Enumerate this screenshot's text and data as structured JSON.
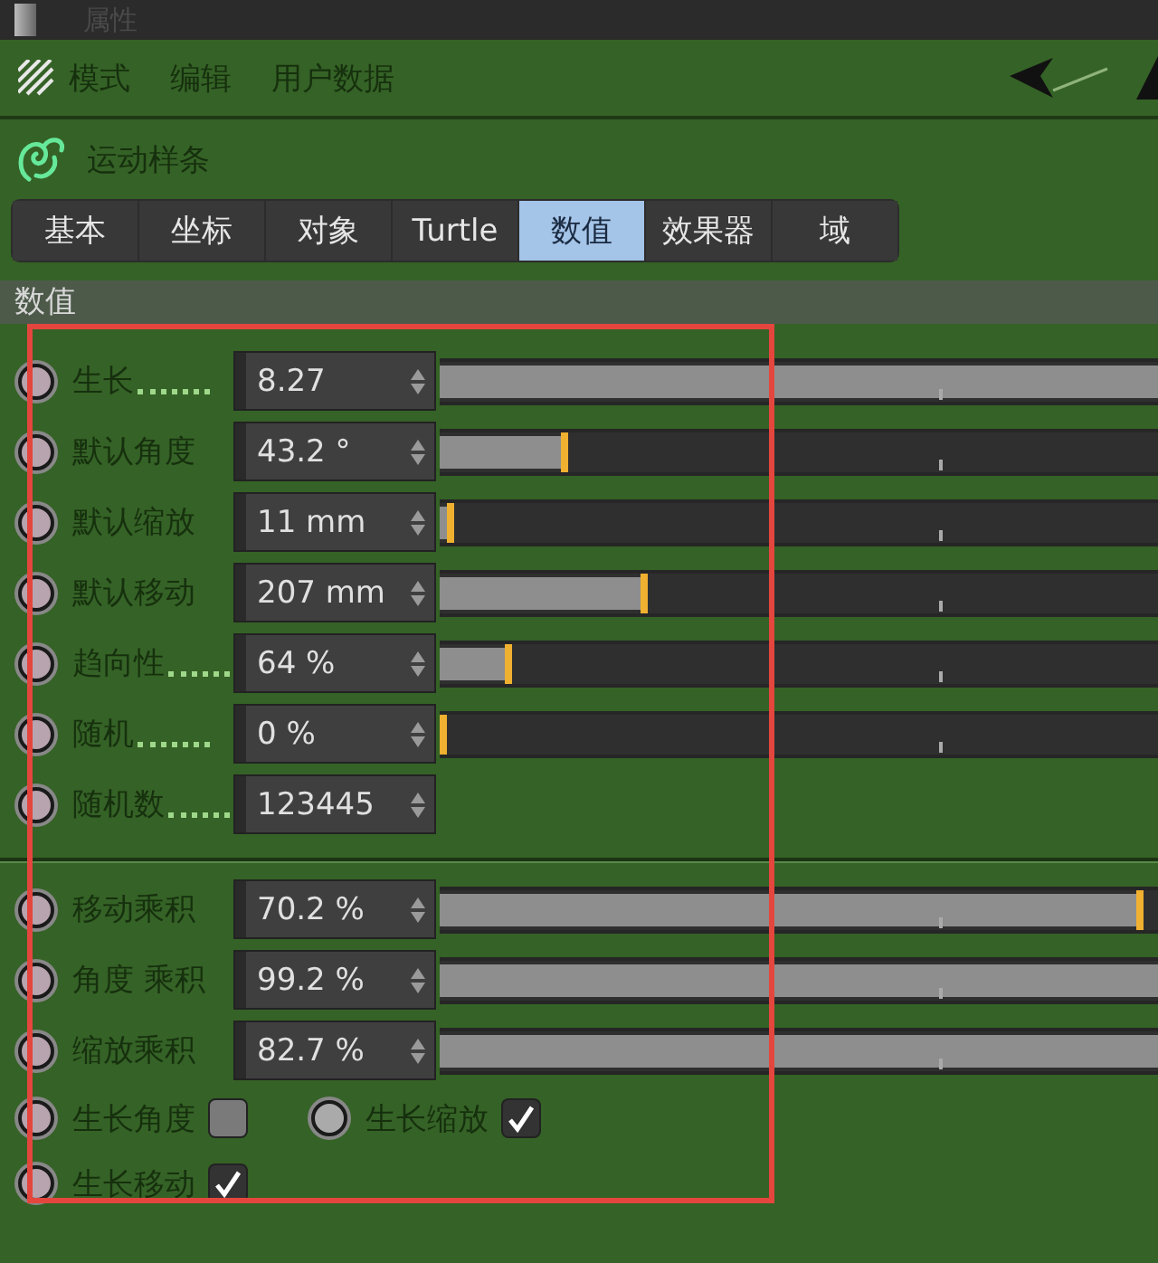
{
  "window": {
    "title": "属性"
  },
  "menu": [
    "模式",
    "编辑",
    "用户数据"
  ],
  "object": {
    "name": "运动样条"
  },
  "tabs": [
    {
      "label": "基本",
      "selected": false
    },
    {
      "label": "坐标",
      "selected": false
    },
    {
      "label": "对象",
      "selected": false
    },
    {
      "label": "Turtle",
      "selected": false
    },
    {
      "label": "数值",
      "selected": true
    },
    {
      "label": "效果器",
      "selected": false
    },
    {
      "label": "域",
      "selected": false
    }
  ],
  "section": {
    "title": "数值"
  },
  "groups": [
    {
      "rows": [
        {
          "kind": "slider",
          "label": "生长",
          "dotted": true,
          "value": "8.27",
          "level": 1
        },
        {
          "kind": "slider",
          "label": "默认角度",
          "dotted": false,
          "value": "43.2 °",
          "level": 0.17
        },
        {
          "kind": "slider",
          "label": "默认缩放",
          "dotted": false,
          "value": "11 mm",
          "level": 0.01
        },
        {
          "kind": "slider",
          "label": "默认移动",
          "dotted": false,
          "value": "207 mm",
          "level": 0.28
        },
        {
          "kind": "slider",
          "label": "趋向性",
          "dotted": true,
          "value": "64 %",
          "level": 0.09
        },
        {
          "kind": "slider",
          "label": "随机",
          "dotted": true,
          "value": "0 %",
          "level": 0
        },
        {
          "kind": "number",
          "label": "随机数",
          "dotted": true,
          "value": "123445"
        }
      ]
    },
    {
      "rows": [
        {
          "kind": "slider",
          "label": "移动乘积",
          "dotted": false,
          "value": "70.2 %",
          "level": 0.97
        },
        {
          "kind": "slider",
          "label": "角度 乘积",
          "dotted": false,
          "value": "99.2 %",
          "level": 1
        },
        {
          "kind": "slider",
          "label": "缩放乘积",
          "dotted": false,
          "value": "82.7 %",
          "level": 1
        },
        {
          "kind": "checks",
          "items": [
            {
              "label": "生长角度",
              "checked": false
            },
            {
              "label": "生长缩放",
              "checked": true
            }
          ]
        },
        {
          "kind": "checks",
          "items": [
            {
              "label": "生长移动",
              "checked": true
            }
          ]
        }
      ]
    }
  ]
}
